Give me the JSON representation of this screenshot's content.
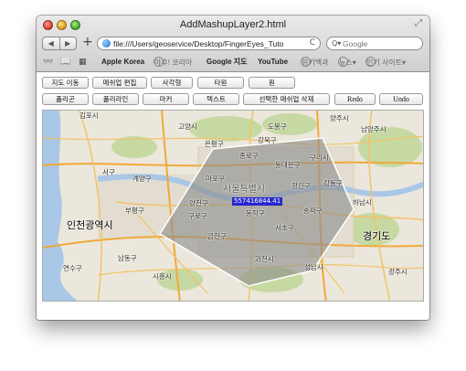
{
  "window": {
    "title": "AddMashupLayer2.html",
    "back_glyph": "◀",
    "forward_glyph": "▶",
    "new_tab_glyph": "+",
    "resize_glyph": "⤢"
  },
  "address_bar": {
    "url": "file:///Users/geoservice/Desktop/FingerEyes_Tuto",
    "reload_glyph": "C"
  },
  "search": {
    "placeholder": "Google",
    "icon_glyph": "Q▾"
  },
  "bookmarks": {
    "items": [
      "Apple Korea",
      "야후! 코리아",
      "Google 지도",
      "YouTube",
      "위키백과",
      "뉴스▾",
      "인기 사이트▾"
    ]
  },
  "toolbar_row1": [
    "지도 이동",
    "매쉬업 편집",
    "사각형",
    "타원",
    "원"
  ],
  "toolbar_row2": [
    "폴리곤",
    "폴리라인",
    "마커",
    "텍스트",
    "선택한 매쉬업 삭제",
    "Redo",
    "Undo"
  ],
  "map": {
    "labels": [
      "김포시",
      "고양시",
      "도봉구",
      "양주시",
      "남양주시",
      "은평구",
      "강북구",
      "종로구",
      "동대문구",
      "구리시",
      "서구",
      "계양구",
      "마포구",
      "광진구",
      "강동구",
      "부평구",
      "양천구",
      "서울특별시",
      "송파구",
      "하남시",
      "남동구",
      "구로구",
      "동작구",
      "서초구",
      "금천구",
      "인천광역시",
      "경기도",
      "연수구",
      "시흥시",
      "과천시",
      "성남시",
      "광주시"
    ],
    "area_label": "557416844.41",
    "colors": {
      "polygon_fill": "#8c8c8c",
      "area_label_bg": "#2626d0",
      "road_major": "#f0a93a",
      "water": "#a9c7e6",
      "park": "#c6d9a2"
    }
  }
}
